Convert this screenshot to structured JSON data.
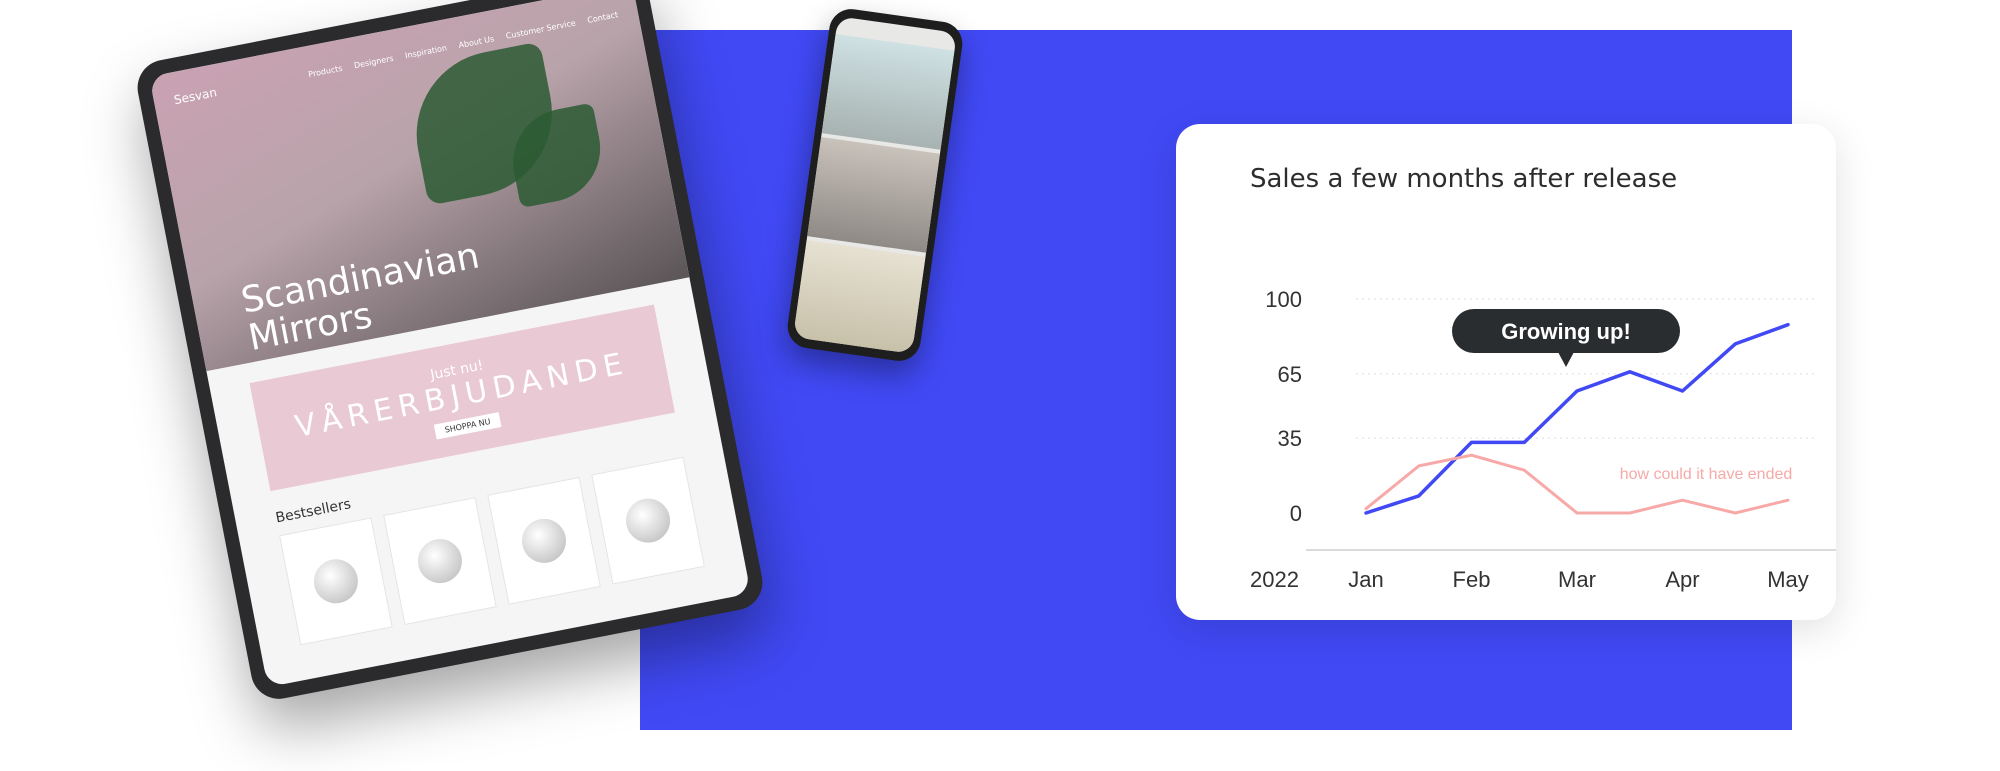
{
  "tablet": {
    "brand": "Sesvan",
    "nav": [
      "Products",
      "Designers",
      "Inspiration",
      "About Us",
      "Customer Service",
      "Contact"
    ],
    "hero_title": "Scandinavian\nMirrors",
    "banner": {
      "small": "Just nu!",
      "big": "VÅRERBJUDANDE",
      "button": "SHOPPA NU"
    },
    "bestsellers_label": "Bestsellers"
  },
  "chart_data": {
    "type": "line",
    "title": "Sales a few months after release",
    "x": [
      "Jan",
      "Feb",
      "Mar",
      "Apr",
      "May"
    ],
    "x_prefix_label": "2022",
    "yticks": [
      0,
      35,
      65,
      100
    ],
    "series": [
      {
        "name": "Growing up!",
        "color": "#4049f4",
        "points": [
          [
            0,
            0
          ],
          [
            0.5,
            8
          ],
          [
            1,
            33
          ],
          [
            1.5,
            33
          ],
          [
            2,
            57
          ],
          [
            2.5,
            66
          ],
          [
            3,
            57
          ],
          [
            3.5,
            79
          ],
          [
            4,
            88
          ]
        ]
      },
      {
        "name": "how could it have ended",
        "color": "#f7a9a8",
        "points": [
          [
            0,
            2
          ],
          [
            0.5,
            22
          ],
          [
            1,
            27
          ],
          [
            1.5,
            20
          ],
          [
            2,
            0
          ],
          [
            2.5,
            0
          ],
          [
            3,
            6
          ],
          [
            3.5,
            0
          ],
          [
            4,
            6
          ]
        ]
      }
    ],
    "callout": "Growing up!",
    "grid": "dotted horizontal"
  }
}
